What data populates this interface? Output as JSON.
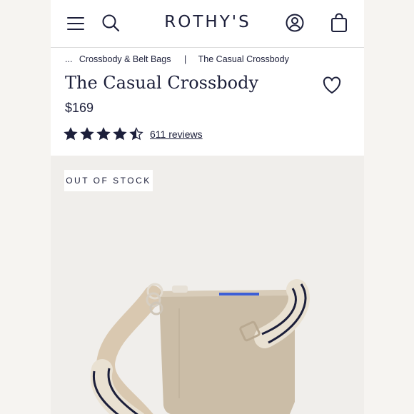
{
  "header": {
    "logo": "ROTHY'S",
    "menu_icon": "menu-icon",
    "search_icon": "search-icon",
    "account_icon": "account-icon",
    "bag_icon": "shopping-bag-icon"
  },
  "breadcrumb": {
    "ellipsis": "...",
    "category": "Crossbody & Belt Bags",
    "separator": "|",
    "current": "The Casual Crossbody"
  },
  "product": {
    "title": "The Casual Crossbody",
    "price": "$169",
    "rating": 4.5,
    "rating_max": 5,
    "reviews_label": "611 reviews",
    "stock_badge": "OUT OF STOCK",
    "wishlist_icon": "heart-icon"
  },
  "colors": {
    "brand_navy": "#1c1f3a",
    "bag_beige": "#cfc1ab",
    "accent_blue": "#3d5fd6"
  }
}
